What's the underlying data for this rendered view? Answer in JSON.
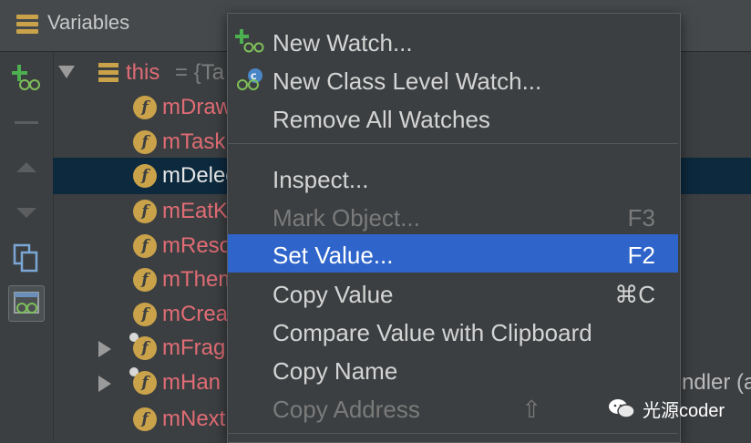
{
  "panel": {
    "title": "Variables"
  },
  "tree": {
    "root": {
      "name": "this",
      "rest": "= {Ta"
    },
    "fields": [
      {
        "name": "mDraw",
        "rest": ""
      },
      {
        "name": "mTask",
        "rest": ""
      },
      {
        "name": "mDeleg",
        "rest": ""
      },
      {
        "name": "mEatK",
        "rest": ""
      },
      {
        "name": "mResou",
        "rest": ""
      },
      {
        "name": "mThem",
        "rest": ""
      },
      {
        "name": "mCrea",
        "rest": ""
      },
      {
        "name": "mFragm",
        "rest": ""
      },
      {
        "name": "mHan",
        "rest": "ndler (an"
      },
      {
        "name": "mNext",
        "rest": ""
      }
    ]
  },
  "menu": {
    "items": [
      {
        "label": "New Watch...",
        "shortcut": ""
      },
      {
        "label": "New Class Level Watch...",
        "shortcut": ""
      },
      {
        "label": "Remove All Watches",
        "shortcut": ""
      },
      {
        "label": "Inspect...",
        "shortcut": ""
      },
      {
        "label": "Mark Object...",
        "shortcut": "F3"
      },
      {
        "label": "Set Value...",
        "shortcut": "F2"
      },
      {
        "label": "Copy Value",
        "shortcut": "⌘C"
      },
      {
        "label": "Compare Value with Clipboard",
        "shortcut": ""
      },
      {
        "label": "Copy Name",
        "shortcut": ""
      },
      {
        "label": "Copy Address",
        "shortcut": "⇧"
      }
    ]
  },
  "watermark": {
    "text": "光源coder"
  },
  "colors": {
    "background": "#3c3f41",
    "selection": "#2f65ca",
    "field_name": "#e06c75",
    "field_icon": "#c9a24a",
    "watch_icon": "#4caf50"
  }
}
